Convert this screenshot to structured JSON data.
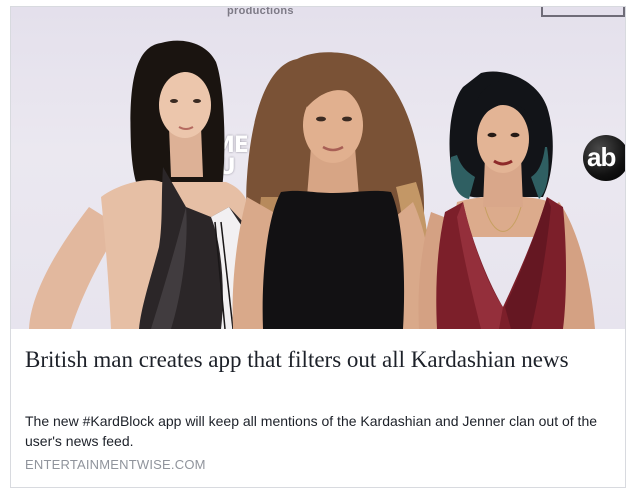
{
  "photo": {
    "backdrop_text": "productions",
    "sponsor_logo": "AME MU",
    "network_logo": "ab"
  },
  "article": {
    "headline": "British man creates app that filters out all Kardashian news",
    "description": "The new #KardBlock app will keep all mentions of the Kardashian and Jenner clan out of the user's news feed.",
    "domain": "ENTERTAINMENTWISE.COM"
  }
}
